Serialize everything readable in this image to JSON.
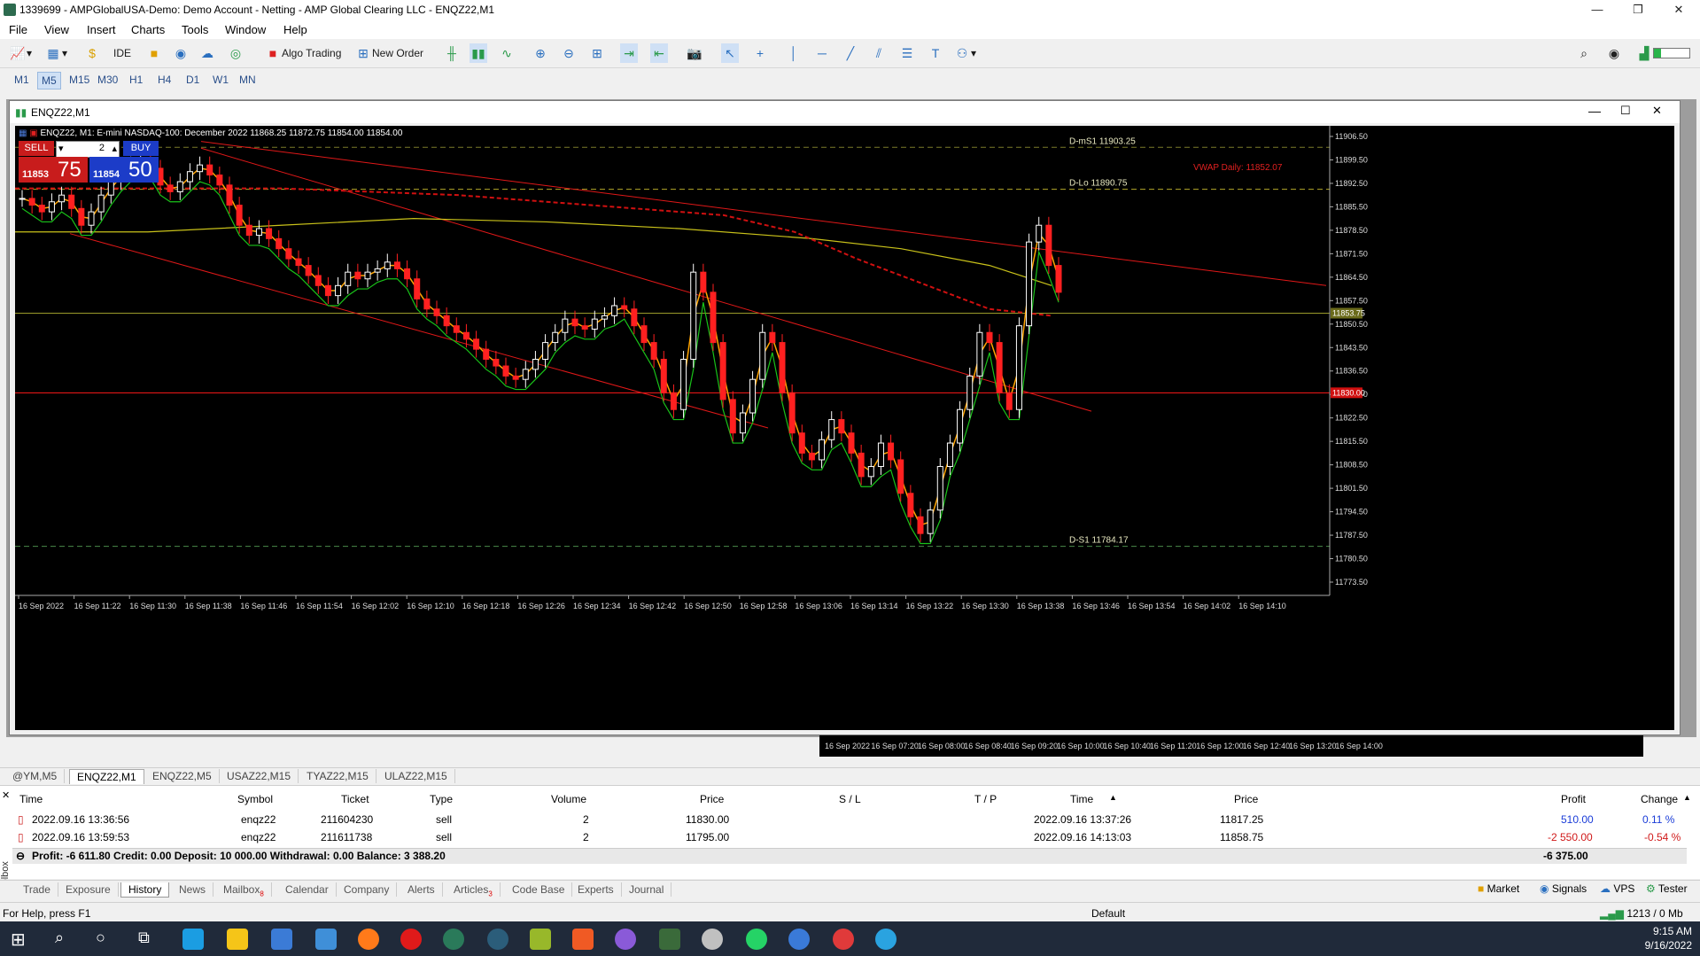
{
  "window": {
    "title": "1339699 - AMPGlobalUSA-Demo: Demo Account - Netting - AMP Global Clearing LLC - ENQZ22,M1"
  },
  "menu": [
    "File",
    "View",
    "Insert",
    "Charts",
    "Tools",
    "Window",
    "Help"
  ],
  "toolbar": {
    "ide": "IDE",
    "algo": "Algo Trading",
    "new_order": "New Order"
  },
  "timeframes": [
    "M1",
    "M5",
    "M15",
    "M30",
    "H1",
    "H4",
    "D1",
    "W1",
    "MN"
  ],
  "active_timeframe": "M5",
  "chart": {
    "window_title": "ENQZ22,M1",
    "info": "ENQZ22, M1:  E-mini NASDAQ-100: December 2022  11868.25  11872.75  11854.00  11854.00",
    "sell_label": "SELL",
    "buy_label": "BUY",
    "volume": "2",
    "sell_price_small": "11853",
    "sell_price_big": "75",
    "buy_price_small": "11854",
    "buy_price_big": "50",
    "level_dms1": "D-mS1 11903.25",
    "level_dlo": "D-Lo 11890.75",
    "level_ds1": "D-S1 11784.17",
    "vwap": "VWAP Daily: 11852.07",
    "current_price_label": "11853.75",
    "red_line_label": "11830.00",
    "price_ticks": [
      "11906.50",
      "11899.50",
      "11892.50",
      "11885.50",
      "11878.50",
      "11871.50",
      "11864.50",
      "11857.50",
      "11850.50",
      "11843.50",
      "11836.50",
      "11829.50",
      "11822.50",
      "11815.50",
      "11808.50",
      "11801.50",
      "11794.50",
      "11787.50",
      "11780.50",
      "11773.50"
    ],
    "time_ticks": [
      "16 Sep 2022",
      "16 Sep 11:22",
      "16 Sep 11:30",
      "16 Sep 11:38",
      "16 Sep 11:46",
      "16 Sep 11:54",
      "16 Sep 12:02",
      "16 Sep 12:10",
      "16 Sep 12:18",
      "16 Sep 12:26",
      "16 Sep 12:34",
      "16 Sep 12:42",
      "16 Sep 12:50",
      "16 Sep 12:58",
      "16 Sep 13:06",
      "16 Sep 13:14",
      "16 Sep 13:22",
      "16 Sep 13:30",
      "16 Sep 13:38",
      "16 Sep 13:46",
      "16 Sep 13:54",
      "16 Sep 14:02",
      "16 Sep 14:10"
    ],
    "bg_time_ticks": [
      "16 Sep 2022",
      "16 Sep 07:20",
      "16 Sep 08:00",
      "16 Sep 08:40",
      "16 Sep 09:20",
      "16 Sep 10:00",
      "16 Sep 10:40",
      "16 Sep 11:20",
      "16 Sep 12:00",
      "16 Sep 12:40",
      "16 Sep 13:20",
      "16 Sep 14:00"
    ]
  },
  "chart_tabs": [
    "@YM,M5",
    "ENQZ22,M1",
    "ENQZ22,M5",
    "USAZ22,M15",
    "TYAZ22,M15",
    "ULAZ22,M15"
  ],
  "active_chart_tab": "ENQZ22,M1",
  "terminal": {
    "columns": [
      "Time",
      "Symbol",
      "Ticket",
      "Type",
      "Volume",
      "Price",
      "S / L",
      "T / P",
      "Time",
      "Price",
      "Profit",
      "Change"
    ],
    "rows": [
      {
        "open_time": "2022.09.16 13:36:56",
        "symbol": "enqz22",
        "ticket": "211604230",
        "type": "sell",
        "volume": "2",
        "price": "11830.00",
        "sl": "",
        "tp": "",
        "close_time": "2022.09.16 13:37:26",
        "close_price": "11817.25",
        "profit": "510.00",
        "change": "0.11 %"
      },
      {
        "open_time": "2022.09.16 13:59:53",
        "symbol": "enqz22",
        "ticket": "211611738",
        "type": "sell",
        "volume": "2",
        "price": "11795.00",
        "sl": "",
        "tp": "",
        "close_time": "2022.09.16 14:13:03",
        "close_price": "11858.75",
        "profit": "-2 550.00",
        "change": "-0.54 %"
      }
    ],
    "summary": "Profit: -6 611.80  Credit: 0.00  Deposit: 10 000.00  Withdrawal: 0.00  Balance: 3 388.20",
    "summary_total": "-6 375.00",
    "toolbox_label": "Toolbox"
  },
  "terminal_tabs": [
    "Trade",
    "Exposure",
    "History",
    "News",
    "Mailbox",
    "Calendar",
    "Company",
    "Alerts",
    "Articles",
    "Code Base",
    "Experts",
    "Journal"
  ],
  "mailbox_badge": "8",
  "articles_badge": "3",
  "active_terminal_tab": "History",
  "right_tabs": [
    "Market",
    "Signals",
    "VPS",
    "Tester"
  ],
  "status": {
    "help": "For Help, press F1",
    "profile": "Default",
    "traffic": "1213 / 0 Mb"
  },
  "taskbar": {
    "time": "9:15 AM",
    "date": "9/16/2022"
  },
  "colors": {
    "bg": "#000000",
    "bull": "#ffffff",
    "bear": "#ff2020",
    "ma_yellow": "#c9c21a",
    "ma_orange": "#ffa500",
    "ma_green": "#19c219",
    "red_line": "#ff1a1a"
  }
}
